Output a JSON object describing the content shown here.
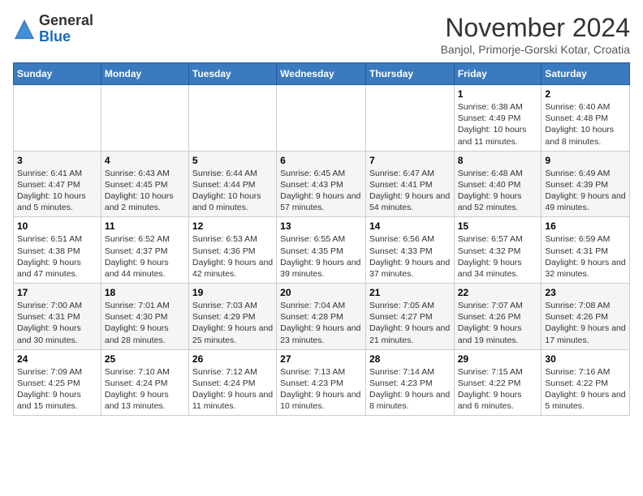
{
  "header": {
    "logo": {
      "general": "General",
      "blue": "Blue"
    },
    "title": "November 2024",
    "location": "Banjol, Primorje-Gorski Kotar, Croatia"
  },
  "weekdays": [
    "Sunday",
    "Monday",
    "Tuesday",
    "Wednesday",
    "Thursday",
    "Friday",
    "Saturday"
  ],
  "weeks": [
    [
      {
        "day": "",
        "info": ""
      },
      {
        "day": "",
        "info": ""
      },
      {
        "day": "",
        "info": ""
      },
      {
        "day": "",
        "info": ""
      },
      {
        "day": "",
        "info": ""
      },
      {
        "day": "1",
        "info": "Sunrise: 6:38 AM\nSunset: 4:49 PM\nDaylight: 10 hours and 11 minutes."
      },
      {
        "day": "2",
        "info": "Sunrise: 6:40 AM\nSunset: 4:48 PM\nDaylight: 10 hours and 8 minutes."
      }
    ],
    [
      {
        "day": "3",
        "info": "Sunrise: 6:41 AM\nSunset: 4:47 PM\nDaylight: 10 hours and 5 minutes."
      },
      {
        "day": "4",
        "info": "Sunrise: 6:43 AM\nSunset: 4:45 PM\nDaylight: 10 hours and 2 minutes."
      },
      {
        "day": "5",
        "info": "Sunrise: 6:44 AM\nSunset: 4:44 PM\nDaylight: 10 hours and 0 minutes."
      },
      {
        "day": "6",
        "info": "Sunrise: 6:45 AM\nSunset: 4:43 PM\nDaylight: 9 hours and 57 minutes."
      },
      {
        "day": "7",
        "info": "Sunrise: 6:47 AM\nSunset: 4:41 PM\nDaylight: 9 hours and 54 minutes."
      },
      {
        "day": "8",
        "info": "Sunrise: 6:48 AM\nSunset: 4:40 PM\nDaylight: 9 hours and 52 minutes."
      },
      {
        "day": "9",
        "info": "Sunrise: 6:49 AM\nSunset: 4:39 PM\nDaylight: 9 hours and 49 minutes."
      }
    ],
    [
      {
        "day": "10",
        "info": "Sunrise: 6:51 AM\nSunset: 4:38 PM\nDaylight: 9 hours and 47 minutes."
      },
      {
        "day": "11",
        "info": "Sunrise: 6:52 AM\nSunset: 4:37 PM\nDaylight: 9 hours and 44 minutes."
      },
      {
        "day": "12",
        "info": "Sunrise: 6:53 AM\nSunset: 4:36 PM\nDaylight: 9 hours and 42 minutes."
      },
      {
        "day": "13",
        "info": "Sunrise: 6:55 AM\nSunset: 4:35 PM\nDaylight: 9 hours and 39 minutes."
      },
      {
        "day": "14",
        "info": "Sunrise: 6:56 AM\nSunset: 4:33 PM\nDaylight: 9 hours and 37 minutes."
      },
      {
        "day": "15",
        "info": "Sunrise: 6:57 AM\nSunset: 4:32 PM\nDaylight: 9 hours and 34 minutes."
      },
      {
        "day": "16",
        "info": "Sunrise: 6:59 AM\nSunset: 4:31 PM\nDaylight: 9 hours and 32 minutes."
      }
    ],
    [
      {
        "day": "17",
        "info": "Sunrise: 7:00 AM\nSunset: 4:31 PM\nDaylight: 9 hours and 30 minutes."
      },
      {
        "day": "18",
        "info": "Sunrise: 7:01 AM\nSunset: 4:30 PM\nDaylight: 9 hours and 28 minutes."
      },
      {
        "day": "19",
        "info": "Sunrise: 7:03 AM\nSunset: 4:29 PM\nDaylight: 9 hours and 25 minutes."
      },
      {
        "day": "20",
        "info": "Sunrise: 7:04 AM\nSunset: 4:28 PM\nDaylight: 9 hours and 23 minutes."
      },
      {
        "day": "21",
        "info": "Sunrise: 7:05 AM\nSunset: 4:27 PM\nDaylight: 9 hours and 21 minutes."
      },
      {
        "day": "22",
        "info": "Sunrise: 7:07 AM\nSunset: 4:26 PM\nDaylight: 9 hours and 19 minutes."
      },
      {
        "day": "23",
        "info": "Sunrise: 7:08 AM\nSunset: 4:26 PM\nDaylight: 9 hours and 17 minutes."
      }
    ],
    [
      {
        "day": "24",
        "info": "Sunrise: 7:09 AM\nSunset: 4:25 PM\nDaylight: 9 hours and 15 minutes."
      },
      {
        "day": "25",
        "info": "Sunrise: 7:10 AM\nSunset: 4:24 PM\nDaylight: 9 hours and 13 minutes."
      },
      {
        "day": "26",
        "info": "Sunrise: 7:12 AM\nSunset: 4:24 PM\nDaylight: 9 hours and 11 minutes."
      },
      {
        "day": "27",
        "info": "Sunrise: 7:13 AM\nSunset: 4:23 PM\nDaylight: 9 hours and 10 minutes."
      },
      {
        "day": "28",
        "info": "Sunrise: 7:14 AM\nSunset: 4:23 PM\nDaylight: 9 hours and 8 minutes."
      },
      {
        "day": "29",
        "info": "Sunrise: 7:15 AM\nSunset: 4:22 PM\nDaylight: 9 hours and 6 minutes."
      },
      {
        "day": "30",
        "info": "Sunrise: 7:16 AM\nSunset: 4:22 PM\nDaylight: 9 hours and 5 minutes."
      }
    ]
  ]
}
